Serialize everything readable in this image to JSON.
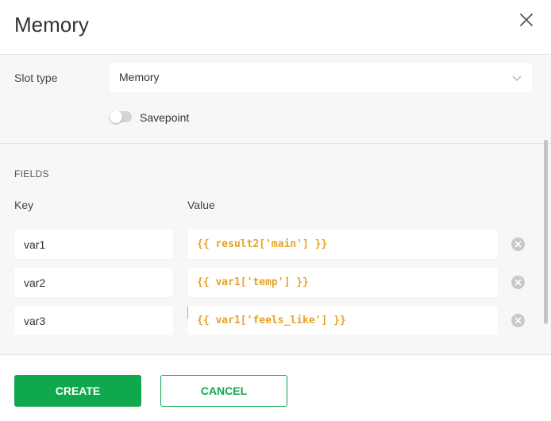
{
  "dialog": {
    "title": "Memory",
    "close_icon": "close-icon"
  },
  "slot": {
    "label": "Slot type",
    "selected": "Memory",
    "chevron_icon": "chevron-down-icon"
  },
  "savepoint": {
    "label": "Savepoint",
    "enabled": false
  },
  "fields": {
    "title": "FIELDS",
    "key_header": "Key",
    "value_header": "Value",
    "rows": [
      {
        "key": "var1",
        "value": "{{ result2['main'] }}"
      },
      {
        "key": "var2",
        "value": "{{ var1['temp'] }}"
      },
      {
        "key": "var3",
        "value": "{{ var1['feels_like'] }}"
      }
    ]
  },
  "actions": {
    "create": "CREATE",
    "cancel": "CANCEL"
  },
  "colors": {
    "primary": "#0fa84d",
    "template_value": "#e8a227",
    "panel_bg": "#f7f7f7"
  }
}
